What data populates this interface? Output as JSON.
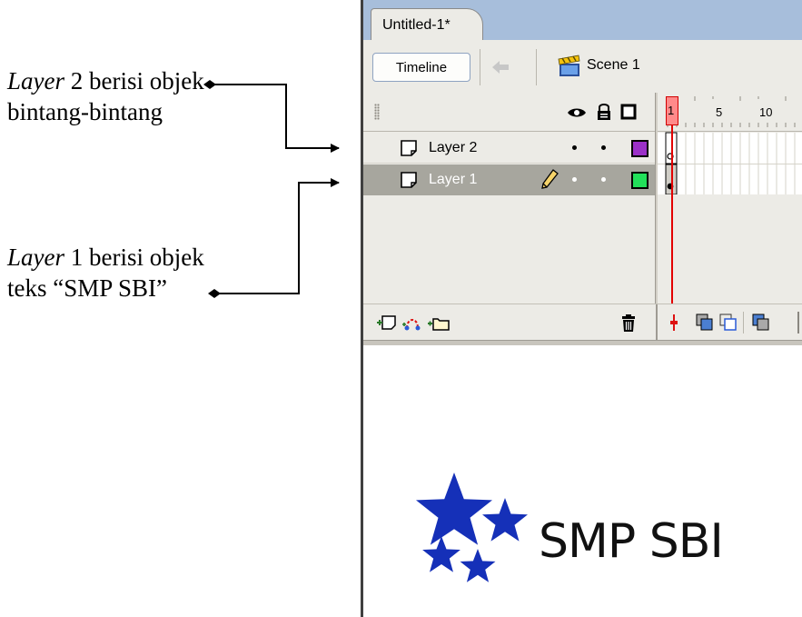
{
  "annotations": {
    "layer2_em": "Layer",
    "layer2_rest": " 2 berisi objek",
    "layer2_line2": "bintang-bintang",
    "layer1_em": "Layer",
    "layer1_rest": " 1 berisi objek",
    "layer1_line2": "teks “SMP SBI”"
  },
  "window": {
    "doc_tab": "Untitled-1*",
    "timeline_button": "Timeline",
    "scene_label": "Scene 1"
  },
  "timeline": {
    "header_icons": [
      "eye-icon",
      "lock-icon",
      "outline-icon"
    ],
    "ruler": [
      "1",
      "5",
      "10"
    ],
    "current_frame": "1",
    "layers": [
      {
        "name": "Layer 2",
        "outline_color": "#9b30c8",
        "selected": false
      },
      {
        "name": "Layer 1",
        "outline_color": "#22e05a",
        "selected": true
      }
    ],
    "footer_icons": [
      "insert-layer-icon",
      "add-motion-guide-icon",
      "insert-folder-icon",
      "delete-layer-icon",
      "center-frame-icon",
      "onion-skin-icon",
      "onion-skin-outlines-icon",
      "edit-multiple-frames-icon"
    ]
  },
  "stage": {
    "logo_text": "SMP SBI",
    "star_color": "#1530b8"
  }
}
